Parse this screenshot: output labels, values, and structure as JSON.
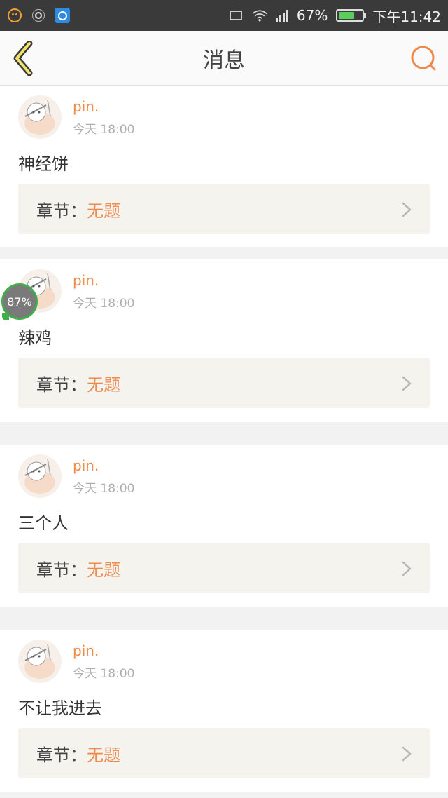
{
  "status_bar": {
    "battery_percent": "67%",
    "time": "下午11:42",
    "battery_level": 0.67,
    "icons": [
      "emoji-icon",
      "brightness-icon",
      "app-icon",
      "cast-icon",
      "wifi-icon",
      "signal-icon",
      "battery-icon"
    ]
  },
  "header": {
    "title": "消息",
    "back_icon": "chevron-left-icon",
    "search_icon": "search-icon"
  },
  "messages": [
    {
      "user": "pin.",
      "time": "今天 18:00",
      "text": "神经饼",
      "chapter_label": "章节：",
      "chapter_title": "无题"
    },
    {
      "user": "pin.",
      "time": "今天 18:00",
      "text": "辣鸡",
      "chapter_label": "章节：",
      "chapter_title": "无题"
    },
    {
      "user": "pin.",
      "time": "今天 18:00",
      "text": "三个人",
      "chapter_label": "章节：",
      "chapter_title": "无题"
    },
    {
      "user": "pin.",
      "time": "今天 18:00",
      "text": "不让我进去",
      "chapter_label": "章节：",
      "chapter_title": "无题"
    }
  ],
  "floating_badge": {
    "label": "87%"
  },
  "colors": {
    "accent": "#f08a4b",
    "status_bar_bg": "#3a3a3a",
    "chapter_bg": "#f4f3ee",
    "badge_border": "#3fae4a"
  }
}
